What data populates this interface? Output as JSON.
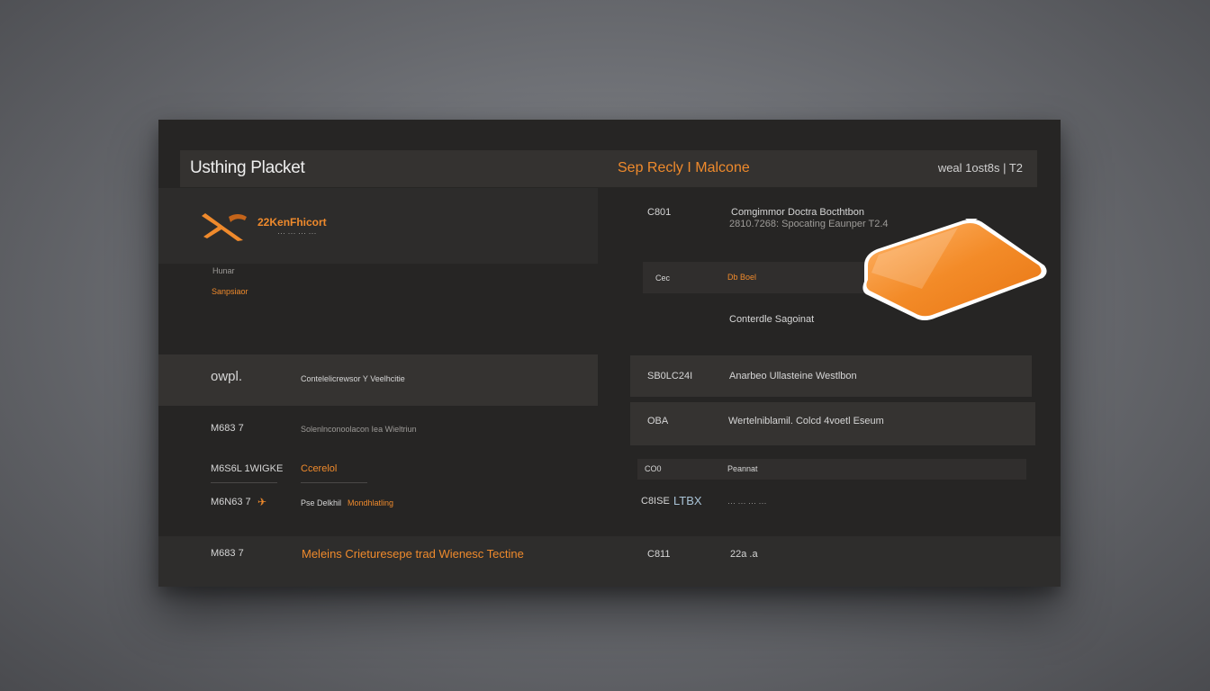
{
  "header": {
    "title": "Usthing Placket",
    "center_brand": "Sep Recly I Malcone",
    "right_status": "weal 1ost8s  |  T2"
  },
  "brand": {
    "name": "22KenFhicort",
    "tagline": "··· ··· ··· ···"
  },
  "left": {
    "mini_label": "Hunar",
    "mini_sub": "Sanpsiaor"
  },
  "right_top": {
    "row1_code": "C801",
    "row1_title": "Comgimmor Doctra Bocthtbon",
    "row1_sub": "2810.7268: Spocating Eaunper T2.4",
    "row2_code": "Cec",
    "row2_val": "Db Boel",
    "row3_text": "Conterdle Sagoinat"
  },
  "table": {
    "left_rows": [
      {
        "code": "owpl.",
        "text": "Contelelicrewsor Y Veelhcitie"
      },
      {
        "code": "M683 7",
        "text": "Solenlnconoolacon Iea Wieltriun"
      },
      {
        "code": "M6S6L 1WIGKE",
        "text": "Ccerelol"
      },
      {
        "code": "M6N63 7",
        "text": "Pse Delkhil",
        "text_accent": "Mondhlatling"
      }
    ],
    "right_rows": [
      {
        "code": "SB0LC24I",
        "text": "Anarbeo Ullasteine  Westlbon"
      },
      {
        "code": "OBA",
        "text": "Wertelniblamil. Colcd 4voetl Eseum"
      },
      {
        "code": "CO0",
        "text": "Peannat"
      },
      {
        "code": "C8ISE",
        "code_accent": "LTBX",
        "text": "··· ··· ··· ···"
      }
    ],
    "footer_left_code": "M683 7",
    "footer_left_text": "Meleins Crieturesepe trad Wienesc Tectine",
    "footer_right_code": "C811",
    "footer_right_val": "22a .a"
  },
  "colors": {
    "accent": "#ef8a2c",
    "panel_bg": "#262524",
    "bar_bg": "#343230"
  }
}
